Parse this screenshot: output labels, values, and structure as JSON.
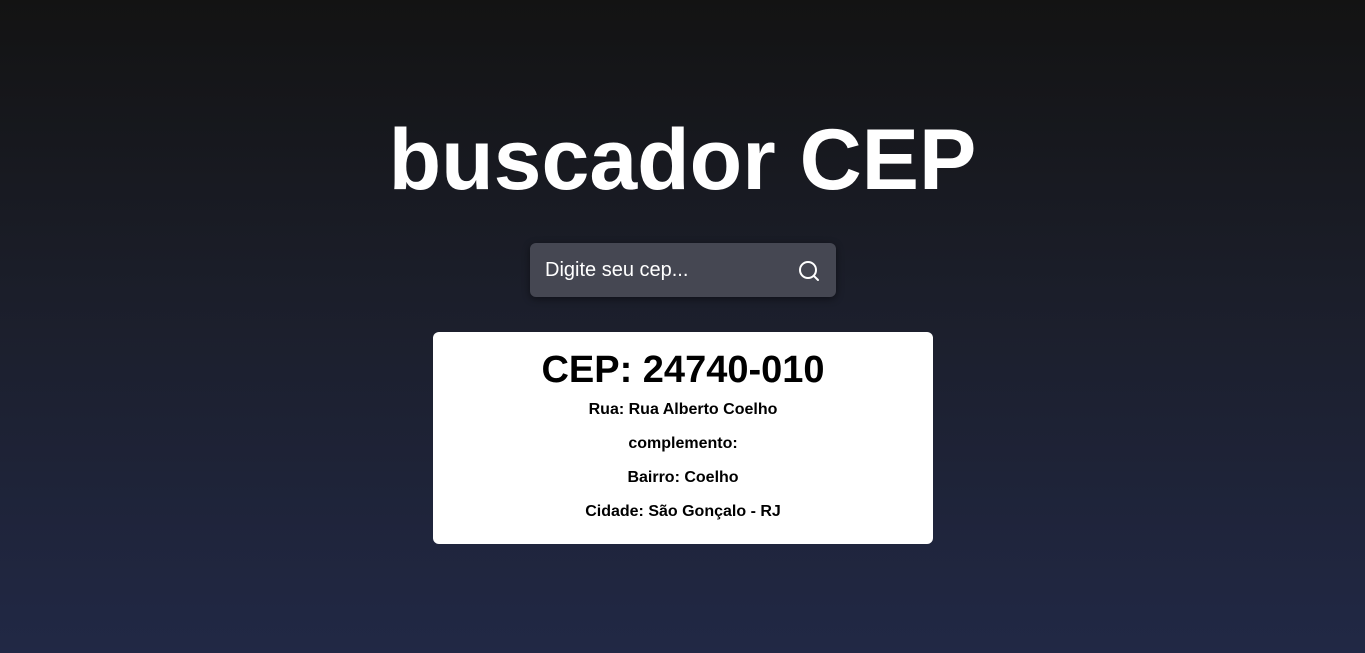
{
  "header": {
    "title": "buscador CEP"
  },
  "search": {
    "placeholder": "Digite seu cep...",
    "value": "",
    "icon": "search-icon"
  },
  "result": {
    "cep_line": "CEP: 24740-010",
    "rua_line": "Rua: Rua Alberto Coelho",
    "complemento_line": "complemento:",
    "bairro_line": "Bairro: Coelho",
    "cidade_line": "Cidade: São Gonçalo - RJ"
  },
  "colors": {
    "background_top": "#131313",
    "background_bottom": "#212845",
    "search_box": "#454752",
    "card": "#ffffff",
    "text_light": "#ffffff",
    "text_dark": "#000000"
  }
}
